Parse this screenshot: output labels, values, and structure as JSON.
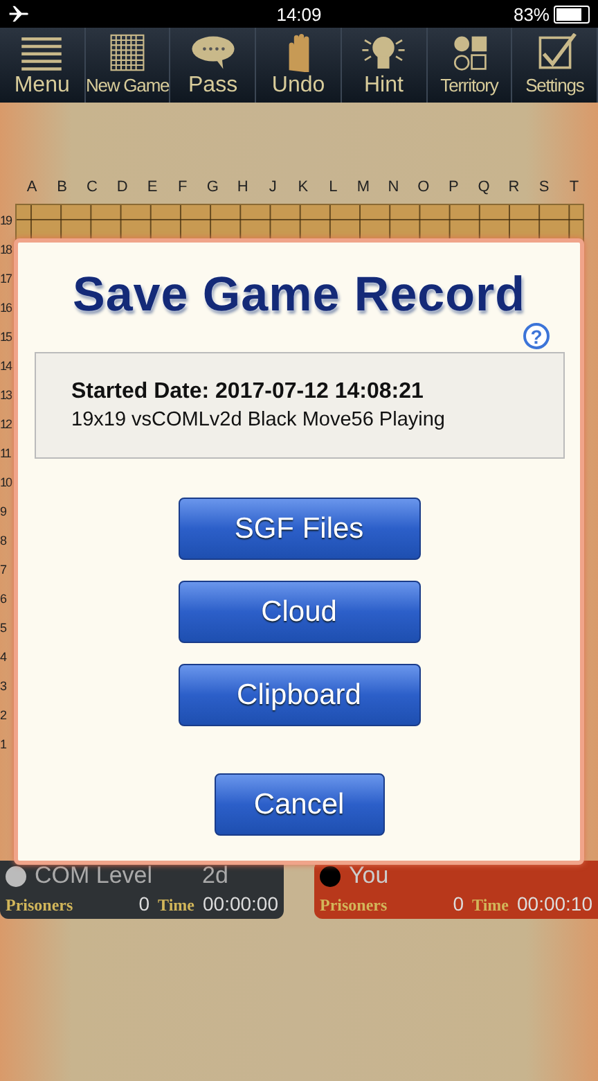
{
  "status_bar": {
    "time": "14:09",
    "battery": "83%"
  },
  "toolbar": [
    {
      "kind": "menu",
      "label": "Menu"
    },
    {
      "kind": "grid",
      "label": "New Game"
    },
    {
      "kind": "speech",
      "label": "Pass"
    },
    {
      "kind": "hand",
      "label": "Undo"
    },
    {
      "kind": "bulb",
      "label": "Hint"
    },
    {
      "kind": "shapes",
      "label": "Territory"
    },
    {
      "kind": "check",
      "label": "Settings"
    }
  ],
  "board": {
    "columns": [
      "A",
      "B",
      "C",
      "D",
      "E",
      "F",
      "G",
      "H",
      "J",
      "K",
      "L",
      "M",
      "N",
      "O",
      "P",
      "Q",
      "R",
      "S",
      "T"
    ],
    "rows": [
      "19",
      "18",
      "17",
      "16",
      "15",
      "14",
      "13",
      "12",
      "11",
      "10",
      "9",
      "8",
      "7",
      "6",
      "5",
      "4",
      "3",
      "2",
      "1"
    ]
  },
  "players": [
    {
      "color": "#bbbbbb",
      "name": "COM Level",
      "rank": "2d",
      "prisoners_label": "Prisoners",
      "prisoners": "0",
      "time_label": "Time",
      "time": "00:00:00",
      "selected": false
    },
    {
      "color": "#000000",
      "name": "You",
      "prisoners_label": "Prisoners",
      "prisoners": "0",
      "time_label": "Time",
      "time": "00:00:10",
      "selected": true
    }
  ],
  "dialog": {
    "title": "Save Game Record",
    "help": "?",
    "started": "Started Date: 2017-07-12 14:08:21",
    "details": "19x19 vsCOMLv2d Black Move56 Playing",
    "buttons": [
      "SGF Files",
      "Cloud",
      "Clipboard"
    ],
    "cancel": "Cancel"
  }
}
